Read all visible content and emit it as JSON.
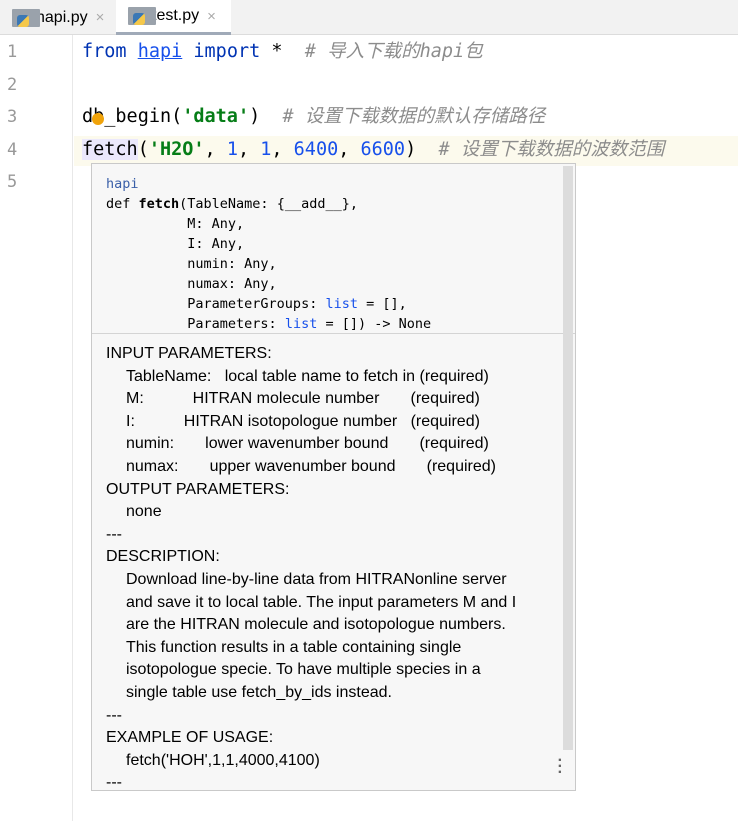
{
  "tabs": [
    {
      "label": "hapi.py",
      "active": false
    },
    {
      "label": "test.py",
      "active": true
    }
  ],
  "close_glyph": "×",
  "line_numbers": [
    "1",
    "2",
    "3",
    "4",
    "5"
  ],
  "code": {
    "l1": {
      "kw1": "from",
      "mod": "hapi",
      "kw2": "import",
      "star": " * ",
      "comment": " # 导入下载的hapi包"
    },
    "l3": {
      "fn": "db_begin(",
      "str": "'data'",
      "close": ")",
      "comment": "  # 设置下载数据的默认存储路径"
    },
    "l4": {
      "fn": "fetch",
      "open": "(",
      "str": "'H2O'",
      "c1": ", ",
      "n1": "1",
      "c2": ", ",
      "n2": "1",
      "c3": ", ",
      "n3": "6400",
      "c4": ", ",
      "n4": "6600",
      "close": ")",
      "comment": "  # 设置下载数据的波数范围"
    }
  },
  "popup": {
    "module": "hapi",
    "sig_lines": [
      "def fetch(TableName: {__add__},",
      "          M: Any,",
      "          I: Any,",
      "          numin: Any,",
      "          numax: Any,",
      "          ParameterGroups: list = [],",
      "          Parameters: list = []) -> None"
    ],
    "doc": [
      {
        "t": "INPUT PARAMETERS:",
        "i": 0
      },
      {
        "t": "TableName:   local table name to fetch in (required)",
        "i": 1
      },
      {
        "t": "M:           HITRAN molecule number       (required)",
        "i": 1
      },
      {
        "t": "I:           HITRAN isotopologue number   (required)",
        "i": 1
      },
      {
        "t": "numin:       lower wavenumber bound       (required)",
        "i": 1
      },
      {
        "t": "numax:       upper wavenumber bound       (required)",
        "i": 1
      },
      {
        "t": "OUTPUT PARAMETERS:",
        "i": 0
      },
      {
        "t": "none",
        "i": 1
      },
      {
        "t": "---",
        "i": 0
      },
      {
        "t": "DESCRIPTION:",
        "i": 0
      },
      {
        "t": "Download line-by-line data from HITRANonline server",
        "i": 1
      },
      {
        "t": "and save it to local table. The input parameters M and I",
        "i": 1
      },
      {
        "t": "are the HITRAN molecule and isotopologue numbers.",
        "i": 1
      },
      {
        "t": "This function results in a table containing single",
        "i": 1
      },
      {
        "t": "isotopologue specie. To have multiple species in a",
        "i": 1
      },
      {
        "t": "single table use fetch_by_ids instead.",
        "i": 1
      },
      {
        "t": "---",
        "i": 0
      },
      {
        "t": "EXAMPLE OF USAGE:",
        "i": 0
      },
      {
        "t": "fetch('HOH',1,1,4000,4100)",
        "i": 1
      },
      {
        "t": "---",
        "i": 0
      }
    ]
  }
}
